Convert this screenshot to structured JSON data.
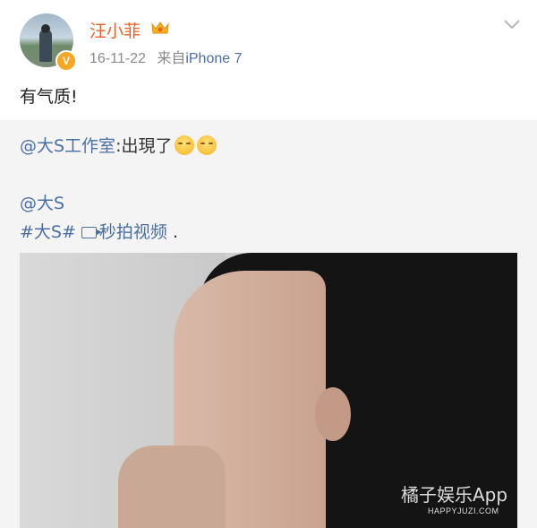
{
  "post": {
    "username": "汪小菲",
    "badge": "V",
    "date": "16-11-22",
    "source_prefix": "来自",
    "device": "iPhone 7",
    "text": "有气质!"
  },
  "repost": {
    "line1_mention": "@大S工作室",
    "line1_text": ":出現了",
    "line2_mention": "@大S",
    "line3_tag": "#大S#",
    "line3_video_label": "秒拍视频",
    "line3_end": " ."
  },
  "watermark": {
    "title": "橘子娱乐App",
    "url": "HAPPYJUZI.COM"
  },
  "colors": {
    "username": "#e8602b",
    "link": "#4a6fa5",
    "repost_bg": "#f4f4f4"
  },
  "icons": [
    "crown-icon",
    "chevron-down-icon",
    "verified-icon",
    "smile-emoji-icon",
    "video-camera-icon"
  ]
}
